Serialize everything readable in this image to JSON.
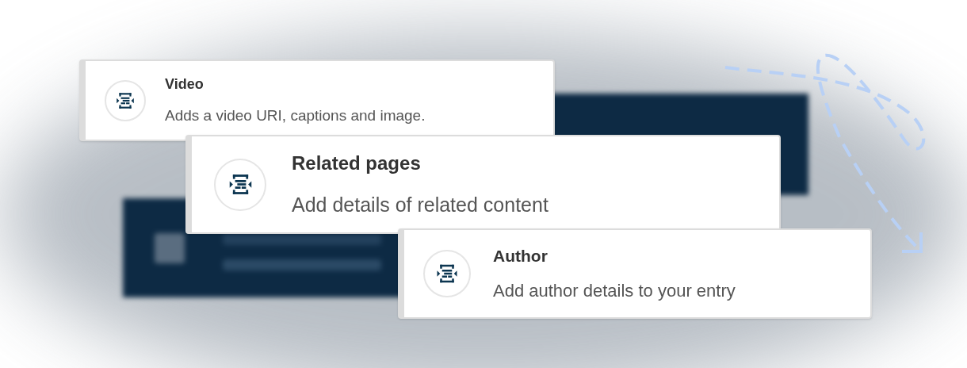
{
  "cards": [
    {
      "title": "Video",
      "description": "Adds a video URI, captions and image."
    },
    {
      "title": "Related pages",
      "description": "Add details of related content"
    },
    {
      "title": "Author",
      "description": "Add author details to your entry"
    }
  ]
}
